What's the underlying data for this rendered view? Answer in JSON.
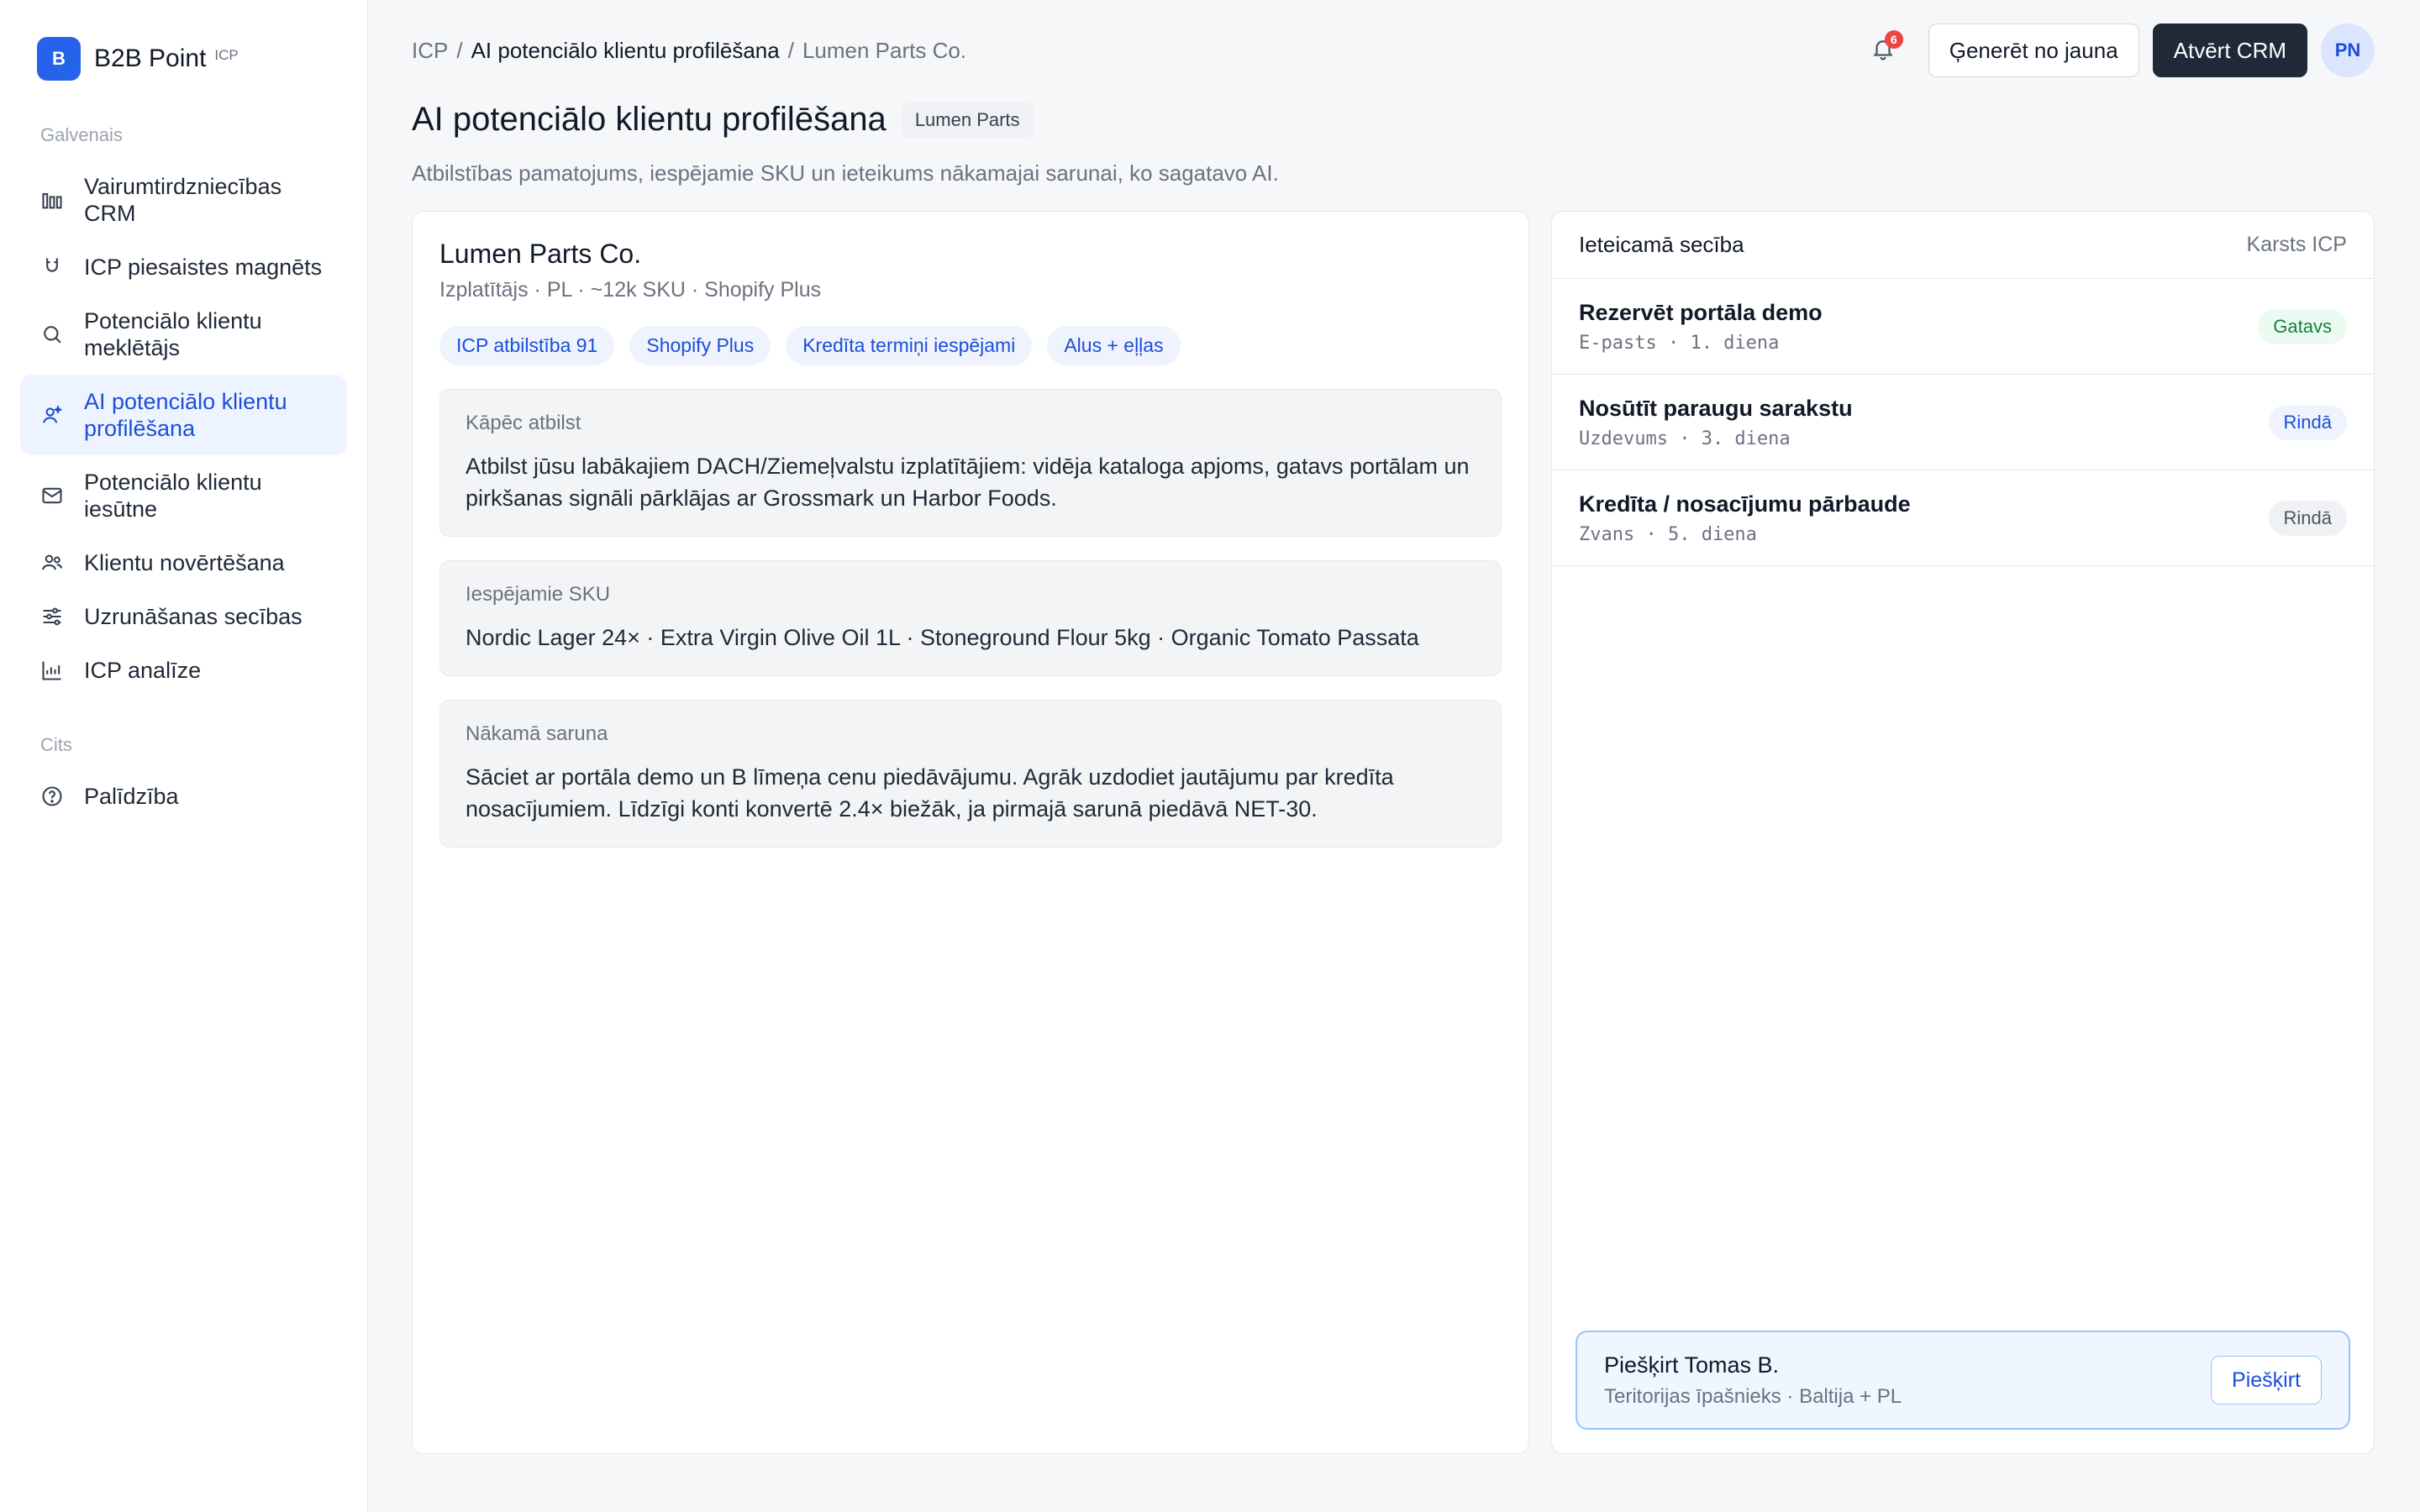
{
  "brand": {
    "logo_letter": "B",
    "name": "B2B Point",
    "tag": "ICP"
  },
  "sidebar": {
    "section_main": "Galvenais",
    "section_other": "Cits",
    "items": [
      {
        "label": "Vairumtirdzniecības CRM",
        "icon": "bars-chart-icon"
      },
      {
        "label": "ICP piesaistes magnēts",
        "icon": "magnet-icon"
      },
      {
        "label": "Potenciālo klientu meklētājs",
        "icon": "search-icon"
      },
      {
        "label": "AI potenciālo klientu profilēšana",
        "icon": "user-sparkle-icon"
      },
      {
        "label": "Potenciālo klientu iesūtne",
        "icon": "mail-icon"
      },
      {
        "label": "Klientu novērtēšana",
        "icon": "users-icon"
      },
      {
        "label": "Uzrunāšanas secības",
        "icon": "sliders-icon"
      },
      {
        "label": "ICP analīze",
        "icon": "analytics-icon"
      }
    ],
    "other_items": [
      {
        "label": "Palīdzība",
        "icon": "help-icon"
      }
    ]
  },
  "breadcrumb": {
    "root": "ICP",
    "section": "AI potenciālo klientu profilēšana",
    "current": "Lumen Parts Co.",
    "sep": "/"
  },
  "topbar": {
    "notification_count": "6",
    "regenerate_label": "Ģenerēt no jauna",
    "open_crm_label": "Atvērt CRM",
    "avatar_initials": "PN"
  },
  "page": {
    "title": "AI potenciālo klientu profilēšana",
    "tag": "Lumen Parts",
    "subtitle": "Atbilstības pamatojums, iespējamie SKU un ieteikums nākamajai sarunai, ko sagatavo AI."
  },
  "profile": {
    "company": "Lumen Parts Co.",
    "meta": "Izplatītājs · PL · ~12k SKU · Shopify Plus",
    "chips": [
      "ICP atbilstība 91",
      "Shopify Plus",
      "Kredīta termiņi iespējami",
      "Alus + eļļas"
    ],
    "panels": [
      {
        "label": "Kāpēc atbilst",
        "text": "Atbilst jūsu labākajiem DACH/Ziemeļvalstu izplatītājiem: vidēja kataloga apjoms, gatavs portālam un pirkšanas signāli pārklājas ar Grossmark un Harbor Foods."
      },
      {
        "label": "Iespējamie SKU",
        "text": "Nordic Lager 24× · Extra Virgin Olive Oil 1L · Stoneground Flour 5kg · Organic Tomato Passata"
      },
      {
        "label": "Nākamā saruna",
        "text": "Sāciet ar portāla demo un B līmeņa cenu piedāvājumu. Agrāk uzdodiet jautājumu par kredīta nosacījumiem. Līdzīgi konti konvertē 2.4× biežāk, ja pirmajā sarunā piedāvā NET-30."
      }
    ]
  },
  "sequence": {
    "title": "Ieteicamā secība",
    "meta": "Karsts ICP",
    "steps": [
      {
        "name": "Rezervēt portāla demo",
        "sub": "E-pasts · 1. diena",
        "status": "Gatavs"
      },
      {
        "name": "Nosūtīt paraugu sarakstu",
        "sub": "Uzdevums · 3. diena",
        "status": "Rindā"
      },
      {
        "name": "Kredīta / nosacījumu pārbaude",
        "sub": "Zvans · 5. diena",
        "status": "Rindā"
      }
    ],
    "assign": {
      "title": "Piešķirt Tomas B.",
      "sub": "Teritorijas īpašnieks · Baltija + PL",
      "button": "Piešķirt"
    }
  },
  "colors": {
    "accent": "#2563eb",
    "dark_button": "#1f2937",
    "ready_green": "#15803d",
    "badge_red": "#ef4444"
  }
}
